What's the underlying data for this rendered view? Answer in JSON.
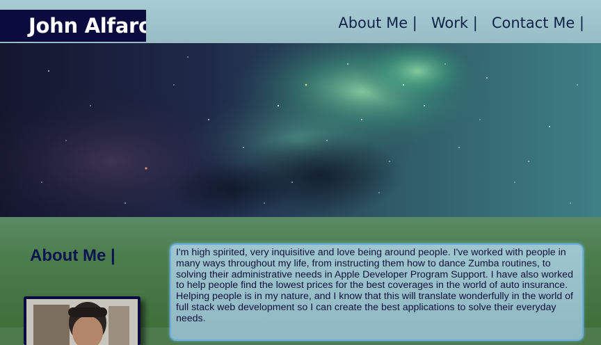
{
  "header": {
    "brand": "John Alfaro",
    "nav": [
      "About Me |",
      "Work |",
      "Contact Me |"
    ]
  },
  "about": {
    "title": "About Me |",
    "bio": "I'm high spirited, very inquisitive and love being around people. I've worked with people in many ways throughout my life, from instructing them how to dance Zumba routines, to solving their administrative needs in Apple Developer Program Support. I have also worked to help people find the lowest prices for the best coverages in the world of auto insurance. Helping people is in my nature, and I know that this will translate wonderfully in the world of full stack web development so I can create the best applications to solve their everyday needs."
  },
  "colors": {
    "header_bg": "#a7ccd3",
    "brand_bg": "#0b0b3f",
    "nav_text": "#10224a",
    "body_bg": "#4e7a4e",
    "bio_bg": "#9ec6cf",
    "bio_border": "#6aaee0"
  }
}
